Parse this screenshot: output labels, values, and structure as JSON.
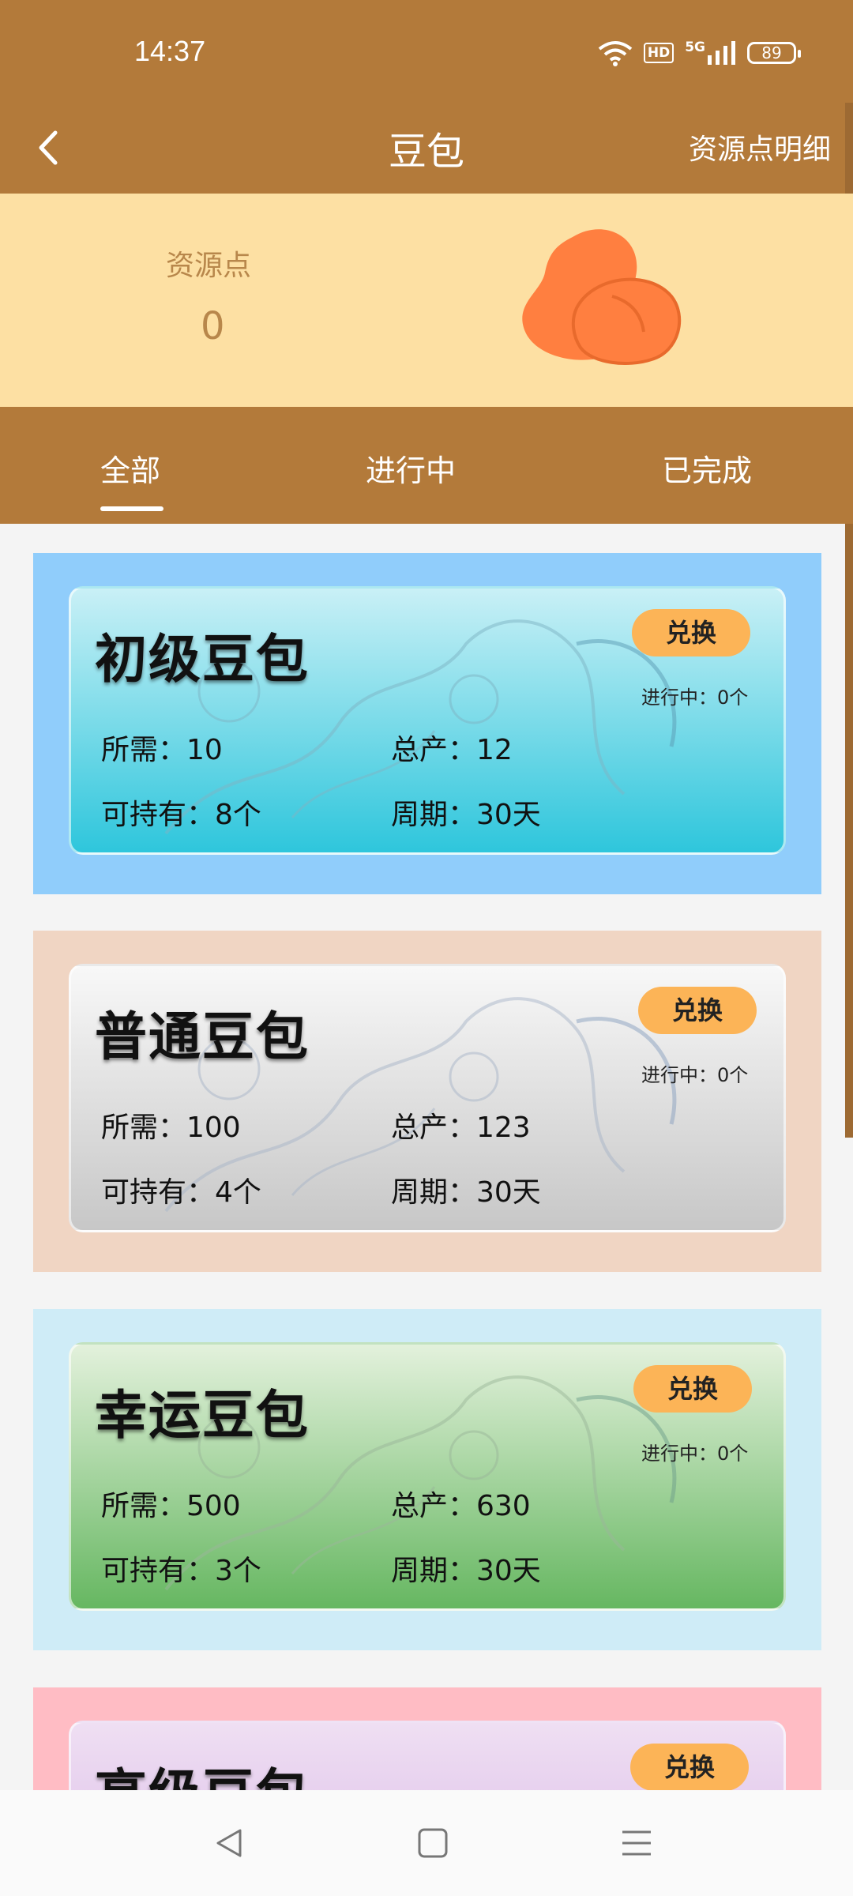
{
  "status_bar": {
    "time": "14:37",
    "network": "5G",
    "hd": "HD",
    "battery": "89"
  },
  "header": {
    "title": "豆包",
    "detail_link": "资源点明细"
  },
  "balance": {
    "label": "资源点",
    "value": "0"
  },
  "tabs": [
    {
      "label": "全部",
      "active": true
    },
    {
      "label": "进行中",
      "active": false
    },
    {
      "label": "已完成",
      "active": false
    }
  ],
  "cards": [
    {
      "title": "初级豆包",
      "button": "兑换",
      "progress": "进行中：0个",
      "required": "所需：10",
      "output": "总产：12",
      "holdable": "可持有：8个",
      "period": "周期：30天"
    },
    {
      "title": "普通豆包",
      "button": "兑换",
      "progress": "进行中：0个",
      "required": "所需：100",
      "output": "总产：123",
      "holdable": "可持有：4个",
      "period": "周期：30天"
    },
    {
      "title": "幸运豆包",
      "button": "兑换",
      "progress": "进行中：0个",
      "required": "所需：500",
      "output": "总产：630",
      "holdable": "可持有：3个",
      "period": "周期：30天"
    },
    {
      "title": "高级豆包",
      "button": "兑换"
    }
  ],
  "colors": {
    "header": "#b37a3a",
    "balance_bg": "#fde0a3",
    "accent_button": "#fcb457",
    "bean": "#ff7f40"
  },
  "nav_icons": [
    "back-triangle-icon",
    "home-square-icon",
    "menu-lines-icon"
  ]
}
